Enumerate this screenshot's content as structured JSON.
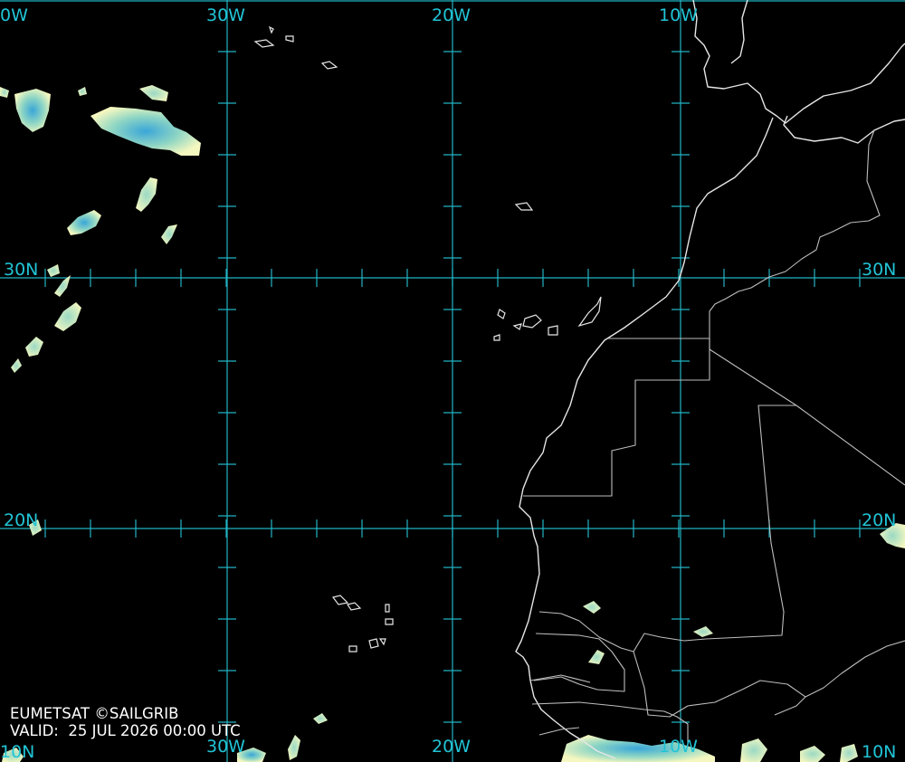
{
  "map": {
    "type": "satellite-imagery",
    "colors": {
      "background": "#000000",
      "graticule": "#21b4c4",
      "coastline": "#e6e6e6",
      "cloud_light": "#f4f7c0",
      "cloud_mid": "#8fd6c4",
      "cloud_dense": "#3aa6d8"
    },
    "graticule": {
      "longitude_labels_top": [
        "0W",
        "30W",
        "20W",
        "10W"
      ],
      "longitude_labels_bottom": [
        "10N",
        "30W",
        "20W",
        "10W",
        "10N"
      ],
      "latitude_labels_left": [
        "30N",
        "20N"
      ],
      "latitude_labels_right": [
        "30N",
        "20N"
      ]
    }
  },
  "credits": {
    "source": "EUMETSAT ©SAILGRIB",
    "valid_label": "VALID:",
    "valid_time": "25 JUL 2026 00:00 UTC"
  }
}
